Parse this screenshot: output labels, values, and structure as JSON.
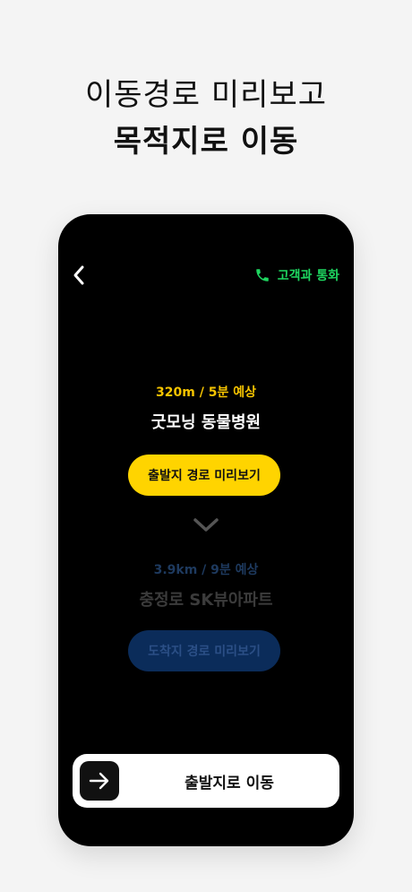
{
  "headline": {
    "line1": "이동경로 미리보고",
    "line2": "목적지로 이동"
  },
  "header": {
    "back_icon": "chevron-left-icon",
    "call_label": "고객과 통화",
    "call_icon": "phone-icon",
    "call_color": "#1ed760"
  },
  "origin": {
    "eta": "320m / 5분 예상",
    "name": "굿모닝 동물병원",
    "preview_label": "출발지 경로 미리보기"
  },
  "divider_icon": "chevron-down-icon",
  "destination": {
    "eta": "3.9km / 9분 예상",
    "name": "충정로 SK뷰아파트",
    "preview_label": "도착지 경로 미리보기"
  },
  "bottom_action": {
    "icon": "arrow-right-icon",
    "label": "출발지로 이동"
  },
  "colors": {
    "accent_yellow": "#ffd400",
    "eta_yellow": "#f5c400",
    "disabled_blue": "#0b2c5a"
  }
}
